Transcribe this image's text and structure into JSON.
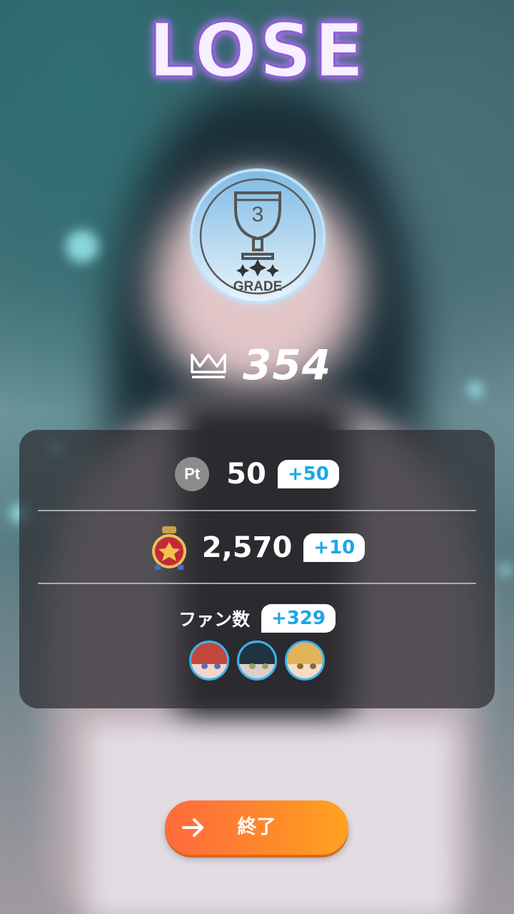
{
  "result": {
    "title": "LOSE"
  },
  "grade": {
    "number": "3",
    "label": "GRADE"
  },
  "score": {
    "value": "354",
    "icon": "crown-icon"
  },
  "rewards": {
    "points": {
      "icon_label": "Pt",
      "value": "50",
      "gain": "+50"
    },
    "currency": {
      "icon": "medal-icon",
      "value": "2,570",
      "gain": "+10"
    },
    "fans": {
      "label": "ファン数",
      "gain": "+329",
      "members": [
        "member-1",
        "member-2",
        "member-3"
      ]
    }
  },
  "finish_button": {
    "label": "終了",
    "icon": "arrow-right-icon"
  },
  "colors": {
    "accent_blue": "#1aa6e8",
    "button_orange": "#ff7a35",
    "title_purple": "#8f5cd6"
  }
}
